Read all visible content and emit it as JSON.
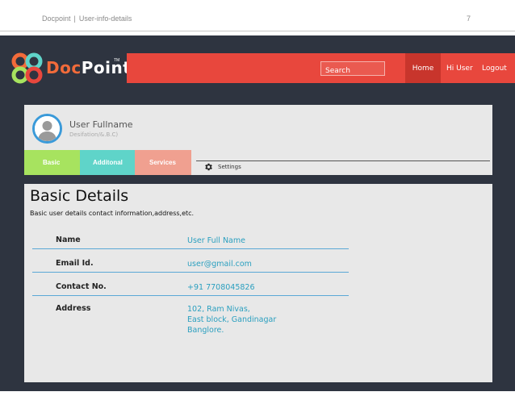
{
  "slide": {
    "title": "Docpoint",
    "separator": "|",
    "subtitle": "User-info-details",
    "page_number": "7"
  },
  "brand": {
    "name_part1": "Doc",
    "name_part2": "Point",
    "trademark": "TM",
    "accent_color": "#e8473d",
    "dark_color": "#2e3440"
  },
  "nav": {
    "search_placeholder": "Search",
    "home": "Home",
    "user": "Hi User",
    "logout": "Logout"
  },
  "profile": {
    "name": "User Fullname",
    "subtitle": "Desifation/&.B.C)",
    "avatar_icon": "user-avatar-icon"
  },
  "tabs": [
    {
      "label": "Basic",
      "color": "#a7e35f"
    },
    {
      "label": "Additonal",
      "color": "#5fd4c9"
    },
    {
      "label": "Services",
      "color": "#f0a090"
    }
  ],
  "settings": {
    "label": "Settings",
    "icon": "gear-icon"
  },
  "details": {
    "title": "Basic Details",
    "subtitle": "Basic user details contact information,address,etc.",
    "rows": [
      {
        "label": "Name",
        "value": "User Full Name"
      },
      {
        "label": "Email Id.",
        "value": "user@gmail.com"
      },
      {
        "label": "Contact No.",
        "value": "+91 7708045826"
      },
      {
        "label": "Address",
        "value": "102, Ram Nivas,\nEast block, Gandinagar\nBanglore."
      }
    ]
  }
}
